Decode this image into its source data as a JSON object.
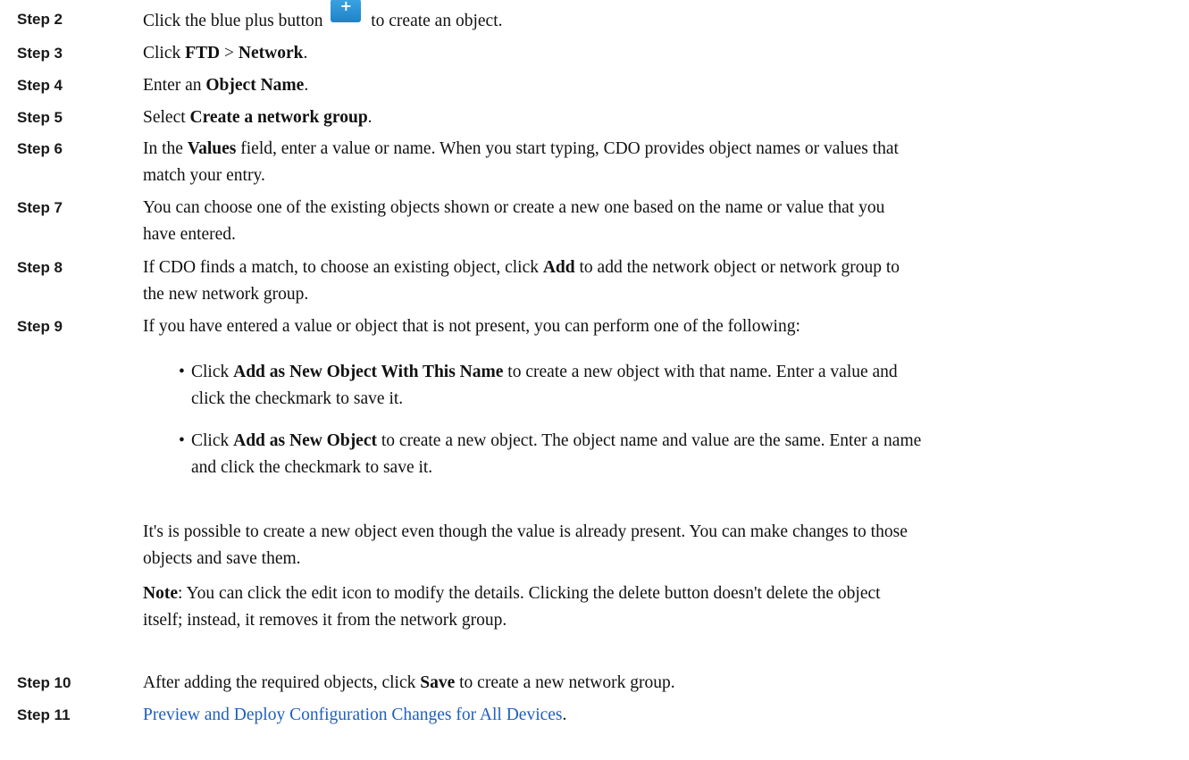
{
  "steps": [
    {
      "label": "Step 2",
      "pre": "Click the blue plus button",
      "plus_glyph": "+",
      "post": " to create an object."
    },
    {
      "label": "Step 3",
      "a": "Click ",
      "b": "FTD",
      "c": " > ",
      "d": "Network",
      "e": "."
    },
    {
      "label": "Step 4",
      "a": "Enter an ",
      "b": "Object Name",
      "c": "."
    },
    {
      "label": "Step 5",
      "a": "Select ",
      "b": "Create a network group",
      "c": "."
    },
    {
      "label": "Step 6",
      "a": "In the ",
      "b": "Values",
      "c": " field, enter a value or name. When you start typing, CDO provides object names or values that",
      "d": "match your entry."
    },
    {
      "label": "Step 7",
      "a": "You can choose one of the existing objects shown or create a new one based on the name or value that you",
      "b": "have entered."
    },
    {
      "label": "Step 8",
      "a": "If CDO finds a match, to choose an existing object, click ",
      "b": "Add",
      "c": " to add the network object or network group to",
      "d": "the new network group."
    },
    {
      "label": "Step 9",
      "a": "If you have entered a value or object that is not present, you can perform one of the following:"
    },
    {
      "label": "Step 10",
      "a": "After adding the required objects, click ",
      "b": "Save",
      "c": " to create a new network group."
    },
    {
      "label": "Step 11",
      "link": "Preview and Deploy Configuration Changes for All Devices",
      "after": "."
    }
  ],
  "bullets": [
    {
      "dot": "•",
      "a": "Click ",
      "b": "Add as New Object With This Name",
      "c": " to create a new object with that name. Enter a value and",
      "d": "click the checkmark to save it."
    },
    {
      "dot": "•",
      "a": "Click ",
      "b": "Add as New Object",
      "c": " to create a new object. The object name and value are the same. Enter a name",
      "d": "and click the checkmark to save it."
    }
  ],
  "para1": {
    "line1": "It's is possible to create a new object even though the value is already present. You can make changes to those",
    "line2": "objects and save them."
  },
  "note": {
    "bold": "Note",
    "line1": ": You can click the edit icon to modify the details. Clicking the delete button doesn't delete the object",
    "line2": "itself; instead, it removes it from the network group."
  }
}
